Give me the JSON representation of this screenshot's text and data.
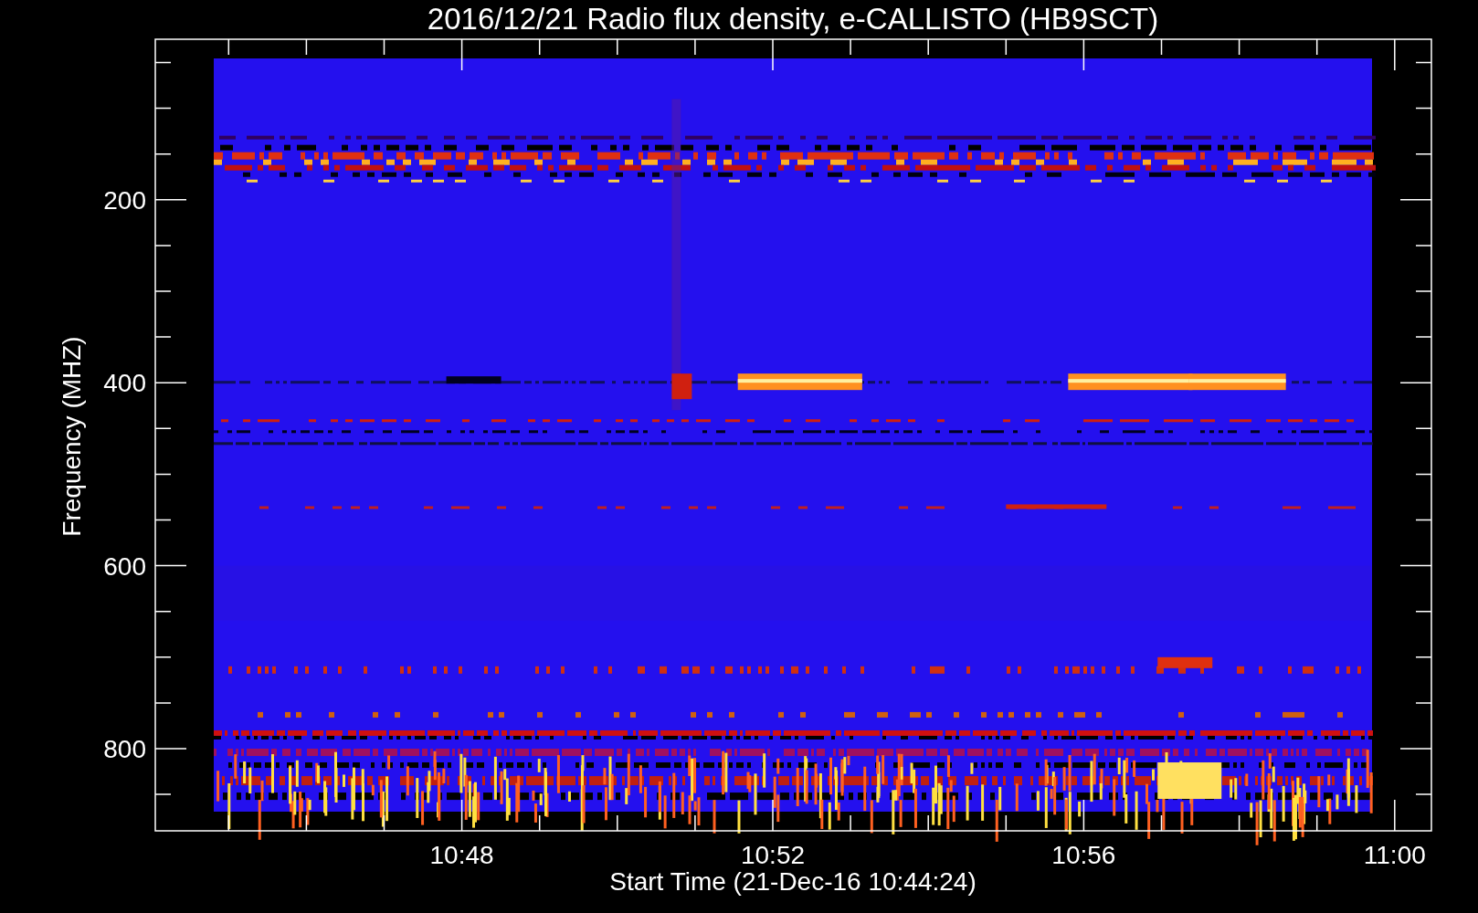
{
  "chart": {
    "title": "2016/12/21  Radio flux density, e-CALLISTO (HB9SCT)",
    "ylabel": "Frequency (MHZ)",
    "xlabel": "Start Time (21-Dec-16 10:44:24)",
    "yticks": [
      "200",
      "400",
      "600",
      "800"
    ],
    "xticks": [
      "10:48",
      "10:52",
      "10:56",
      "11:00"
    ]
  }
}
